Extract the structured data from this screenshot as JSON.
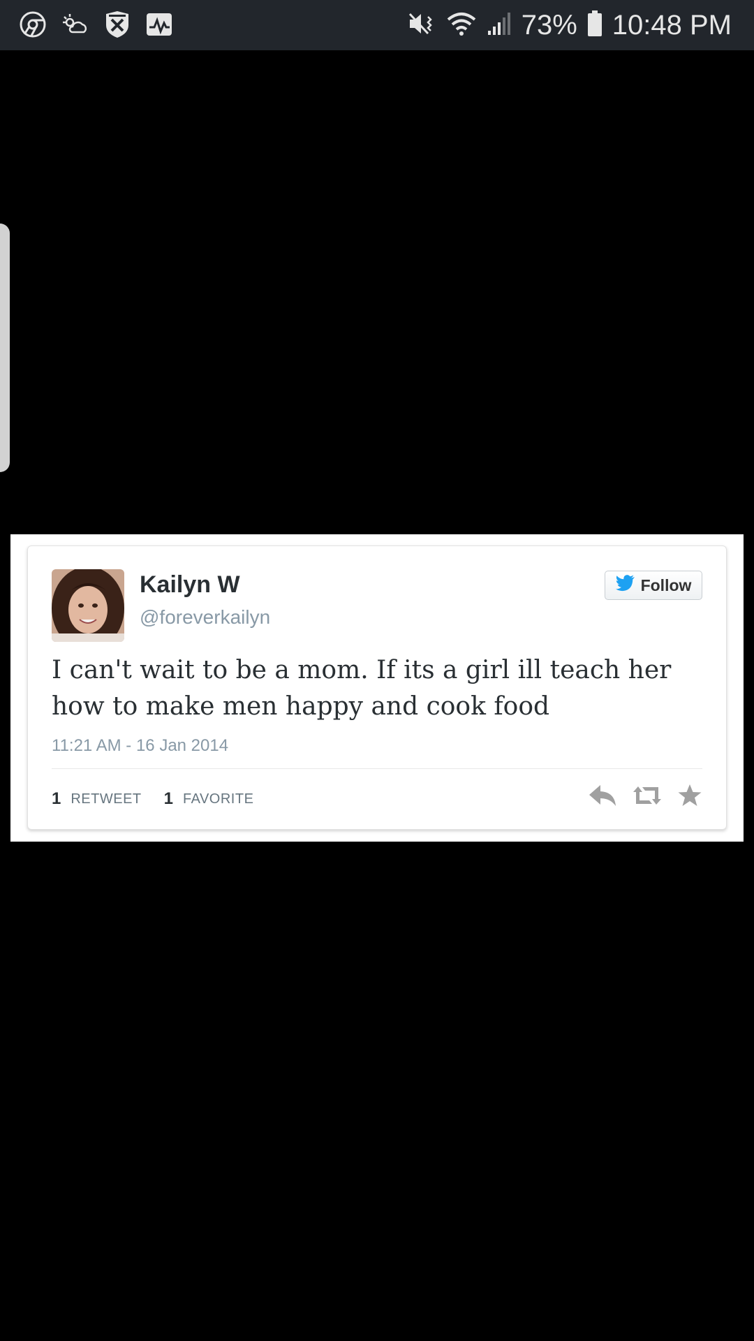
{
  "status_bar": {
    "battery_percent": "73%",
    "time": "10:48 PM",
    "left_icons": [
      "chrome-icon",
      "weather-icon",
      "night-owl-icon",
      "activity-icon"
    ],
    "right_icons": [
      "mute-vibrate-icon",
      "wifi-icon",
      "signal-icon",
      "battery-icon"
    ]
  },
  "tweet": {
    "display_name": "Kailyn W",
    "handle": "@foreverkailyn",
    "follow_label": "Follow",
    "text": "I can't wait to be a mom. If its a girl ill teach her how to make men happy and cook food",
    "timestamp": "11:21 AM - 16 Jan 2014",
    "retweet_count": "1",
    "retweet_label": "RETWEET",
    "favorite_count": "1",
    "favorite_label": "FAVORITE"
  },
  "colors": {
    "status_bar_bg": "#22262c",
    "twitter_blue": "#1da1f2",
    "icon_gray": "#a0a0a0"
  }
}
